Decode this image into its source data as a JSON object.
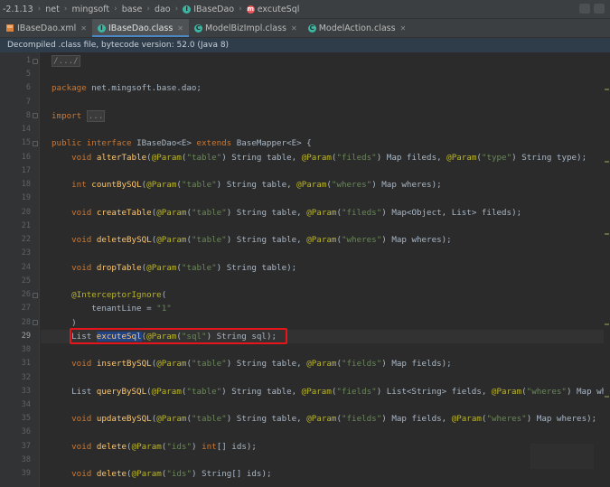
{
  "breadcrumb": [
    {
      "label": "-2.1.13",
      "icon": ""
    },
    {
      "label": "net",
      "icon": ""
    },
    {
      "label": "mingsoft",
      "icon": ""
    },
    {
      "label": "base",
      "icon": ""
    },
    {
      "label": "dao",
      "icon": ""
    },
    {
      "label": "IBaseDao",
      "icon": "interface-icon"
    },
    {
      "label": "excuteSql",
      "icon": "method-icon"
    }
  ],
  "tabs": [
    {
      "label": "IBaseDao.xml",
      "icon": "xml-file-icon",
      "active": false
    },
    {
      "label": "IBaseDao.class",
      "icon": "interface-icon",
      "active": true
    },
    {
      "label": "ModelBizImpl.class",
      "icon": "class-icon",
      "active": false
    },
    {
      "label": "ModelAction.class",
      "icon": "class-icon",
      "active": false
    }
  ],
  "banner": {
    "text": "Decompiled .class file, bytecode version: 52.0 (Java 8)"
  },
  "editor": {
    "current_line": "29",
    "lines": [
      {
        "n": "1",
        "t": "/.../"
      },
      {
        "n": "5",
        "t": ""
      },
      {
        "n": "6",
        "t": "package net.mingsoft.base.dao;"
      },
      {
        "n": "7",
        "t": ""
      },
      {
        "n": "8",
        "t": "import ..."
      },
      {
        "n": "14",
        "t": ""
      },
      {
        "n": "15",
        "t": "public interface IBaseDao<E> extends BaseMapper<E> {"
      },
      {
        "n": "16",
        "t": "    void alterTable(@Param(\"table\") String table, @Param(\"fileds\") Map fileds, @Param(\"type\") String type);"
      },
      {
        "n": "17",
        "t": ""
      },
      {
        "n": "18",
        "t": "    int countBySQL(@Param(\"table\") String table, @Param(\"wheres\") Map wheres);"
      },
      {
        "n": "19",
        "t": ""
      },
      {
        "n": "20",
        "t": "    void createTable(@Param(\"table\") String table, @Param(\"fileds\") Map<Object, List> fileds);"
      },
      {
        "n": "21",
        "t": ""
      },
      {
        "n": "22",
        "t": "    void deleteBySQL(@Param(\"table\") String table, @Param(\"wheres\") Map wheres);"
      },
      {
        "n": "23",
        "t": ""
      },
      {
        "n": "24",
        "t": "    void dropTable(@Param(\"table\") String table);"
      },
      {
        "n": "25",
        "t": ""
      },
      {
        "n": "26",
        "t": "    @InterceptorIgnore("
      },
      {
        "n": "27",
        "t": "        tenantLine = \"1\""
      },
      {
        "n": "28",
        "t": "    )"
      },
      {
        "n": "29",
        "t": "    List excuteSql(@Param(\"sql\") String sql);"
      },
      {
        "n": "30",
        "t": ""
      },
      {
        "n": "31",
        "t": "    void insertBySQL(@Param(\"table\") String table, @Param(\"fields\") Map fields);"
      },
      {
        "n": "32",
        "t": ""
      },
      {
        "n": "33",
        "t": "    List queryBySQL(@Param(\"table\") String table, @Param(\"fields\") List<String> fields, @Param(\"wheres\") Map whe"
      },
      {
        "n": "34",
        "t": ""
      },
      {
        "n": "35",
        "t": "    void updateBySQL(@Param(\"table\") String table, @Param(\"fields\") Map fields, @Param(\"wheres\") Map wheres);"
      },
      {
        "n": "36",
        "t": ""
      },
      {
        "n": "37",
        "t": "    void delete(@Param(\"ids\") int[] ids);"
      },
      {
        "n": "38",
        "t": ""
      },
      {
        "n": "39",
        "t": "    void delete(@Param(\"ids\") String[] ids);"
      }
    ]
  },
  "colors": {
    "keyword": "#cc7832",
    "annotation": "#bbb529",
    "string": "#6a8759",
    "method_name": "#ffc66d",
    "text": "#a9b7c6",
    "highlight_box": "#e8141c",
    "selection": "#214283"
  }
}
